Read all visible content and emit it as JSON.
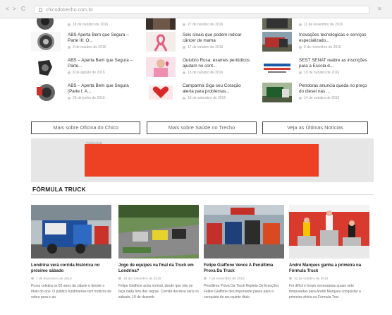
{
  "browser": {
    "back": "<",
    "forward": ">",
    "reload": "C",
    "url": "chicodotrecho.com.br",
    "menu": "≡"
  },
  "news_columns": [
    {
      "items": [
        {
          "title": "",
          "date": "18 de outubro de 2016",
          "thumb": "brake-disc"
        },
        {
          "title": "ABS Aperta Bem que Segura – Parte III: O...",
          "date": "3 de outubro de 2016",
          "thumb": "brake-disc"
        },
        {
          "title": "ABS – Aperta Bem que Segura – Parte...",
          "date": "8 de agosto de 2016",
          "thumb": "brake-caliper"
        },
        {
          "title": "ABS – Aperta Bem que Segura (Parte I: A...",
          "date": "29 de junho de 2016",
          "thumb": "brake-disc-red"
        }
      ]
    },
    {
      "items": [
        {
          "title": "",
          "date": "27 de outubro de 2016",
          "thumb": "health"
        },
        {
          "title": "Seis sinais que podem indicar câncer de mama",
          "date": "17 de outubro de 2016",
          "thumb": "pink-ribbon"
        },
        {
          "title": "Outubro Rosa: exames periódicos ajudam no cont...",
          "date": "13 de outubro de 2016",
          "thumb": "pink-ribbon"
        },
        {
          "title": "Campanha Siga seu Coração alerta para problemas...",
          "date": "16 de setembro de 2016",
          "thumb": "heart-campaign"
        }
      ]
    },
    {
      "items": [
        {
          "title": "",
          "date": "11 de novembro de 2016",
          "thumb": "truck"
        },
        {
          "title": "Inovações tecnológicas e serviços especializado...",
          "date": "6 de novembro de 2016",
          "thumb": "truck"
        },
        {
          "title": "SEST SENAT reabre as inscrições para a Escola d...",
          "date": "19 de outubro de 2016",
          "thumb": "profissional-logo"
        },
        {
          "title": "Petrobras anuncia queda no preço do diesel nas ...",
          "date": "14 de outubro de 2016",
          "thumb": "truck-green"
        }
      ]
    }
  ],
  "more_buttons": [
    "Mais sobre Oficina do Chico",
    "Mais sobre Saúde no Trecho",
    "Veja as Últimas Notícias"
  ],
  "ad": {
    "label": "Publicidade",
    "color": "#ee4124"
  },
  "section": {
    "title": "FÓRMULA TRUCK"
  },
  "cards": [
    {
      "title": "Londrina verá corrida histórica no próximo sábado",
      "date": "7 de dezembro de 2016",
      "excerpt": "Prova celebra os 82 anos da cidade e decide o título do ano. O público londrinense tem motivos de sobra para ir ao",
      "image": "truck-race-blue"
    },
    {
      "title": "Jogo de equipes na final da Truck em Londrina?",
      "date": "16 de novembro de 2016",
      "excerpt": "Felipe Giaffone acha normal, desde que não se faça nada fora das regras. Corrida decisiva será no sábado, 10 de dezemb",
      "image": "truck-race-track"
    },
    {
      "title": "Felipe Giaffone Vence A Penúltima Prova Da Truck",
      "date": "7 de novembro de 2016",
      "excerpt": "Penúltima Prova Da Truck Repleta De Emoções Felipe Giaffone deu importante passo para a conquista do seu quinto título",
      "image": "truck-race-grid"
    },
    {
      "title": "André Marques ganha a primeira na Fórmula Truck",
      "date": "31 de outubro de 2016",
      "excerpt": "Foi difícil e foram necessárias quase sete temporadas para André Marques conquistar a primeira vitória na Fórmula Truc",
      "image": "podium"
    }
  ]
}
